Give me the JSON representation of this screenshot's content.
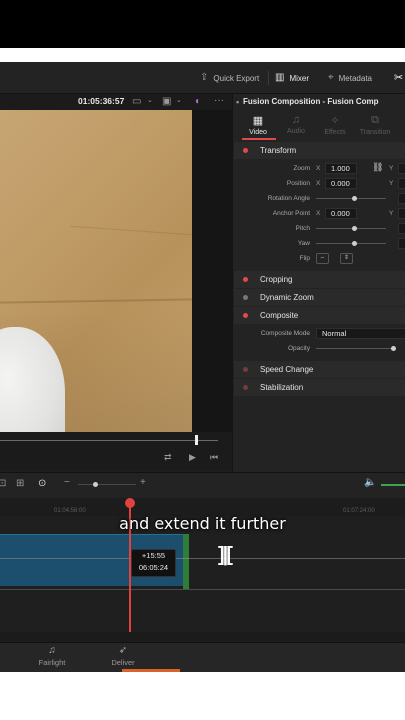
{
  "header": {
    "quick_export": "Quick Export",
    "mixer": "Mixer",
    "metadata": "Metadata"
  },
  "viewer": {
    "timecode": "01:05:36:57"
  },
  "inspector": {
    "title": "Fusion Composition - Fusion Comp",
    "tabs": [
      {
        "label": "Video",
        "icon": "film-icon",
        "active": true
      },
      {
        "label": "Audio",
        "icon": "music-note-icon",
        "active": false
      },
      {
        "label": "Effects",
        "icon": "effects-icon",
        "active": false
      },
      {
        "label": "Transition",
        "icon": "transition-icon",
        "active": false
      }
    ],
    "transform": {
      "header": "Transform",
      "zoom_label": "Zoom",
      "zoom_x": "1.000",
      "position_label": "Position",
      "position_x": "0.000",
      "rotation_label": "Rotation Angle",
      "anchor_label": "Anchor Point",
      "anchor_x": "0.000",
      "pitch_label": "Pitch",
      "yaw_label": "Yaw",
      "flip_label": "Flip",
      "x_axis": "X",
      "y_axis": "Y"
    },
    "cropping": "Cropping",
    "dynamic_zoom": "Dynamic Zoom",
    "composite": {
      "header": "Composite",
      "mode_label": "Composite Mode",
      "mode_value": "Normal",
      "opacity_label": "Opacity"
    },
    "speed_change": "Speed Change",
    "stabilization": "Stabilization",
    "accent_color": "#e04a4a"
  },
  "timeline": {
    "ruler_labels": [
      "01:04:56:00",
      "01:07:24:00"
    ],
    "tooltip_delta": "+15:55",
    "tooltip_time": "06:05:24",
    "caption": "and extend it further",
    "clip_color": "#1c4f6d",
    "playhead_color": "#e0433f"
  },
  "pages": [
    {
      "label": "Fairlight",
      "icon": "music-note-icon"
    },
    {
      "label": "Deliver",
      "icon": "rocket-icon"
    }
  ]
}
